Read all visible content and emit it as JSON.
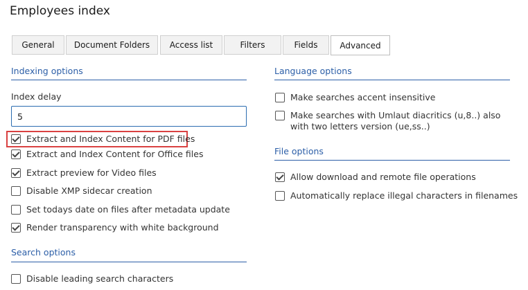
{
  "page": {
    "title": "Employees index"
  },
  "tabs": [
    {
      "label": "General"
    },
    {
      "label": "Document Folders"
    },
    {
      "label": "Access list"
    },
    {
      "label": "Filters"
    },
    {
      "label": "Fields"
    },
    {
      "label": "Advanced",
      "active": true
    }
  ],
  "indexing": {
    "title": "Indexing options",
    "index_delay_label": "Index delay",
    "index_delay_value": "5",
    "options": [
      {
        "label": "Extract and Index Content for PDF files",
        "checked": true
      },
      {
        "label": "Extract and Index Content for Office files",
        "checked": true
      },
      {
        "label": "Extract preview for Video files",
        "checked": true
      },
      {
        "label": "Disable XMP sidecar creation",
        "checked": false
      },
      {
        "label": "Set todays date on files after metadata update",
        "checked": false
      },
      {
        "label": "Render transparency with white background",
        "checked": true
      }
    ]
  },
  "search": {
    "title": "Search options",
    "options": [
      {
        "label": "Disable leading search characters",
        "checked": false
      }
    ]
  },
  "language": {
    "title": "Language options",
    "options": [
      {
        "label": "Make searches accent insensitive",
        "checked": false
      },
      {
        "label": "Make searches with Umlaut diacritics (u,8..) also with two letters version (ue,ss..)",
        "checked": false
      }
    ]
  },
  "file": {
    "title": "File options",
    "options": [
      {
        "label": "Allow download and remote file operations",
        "checked": true
      },
      {
        "label": "Automatically replace illegal characters in filenames",
        "checked": false
      }
    ]
  },
  "colors": {
    "accent": "#2b5ea7",
    "highlight": "#d94141"
  }
}
